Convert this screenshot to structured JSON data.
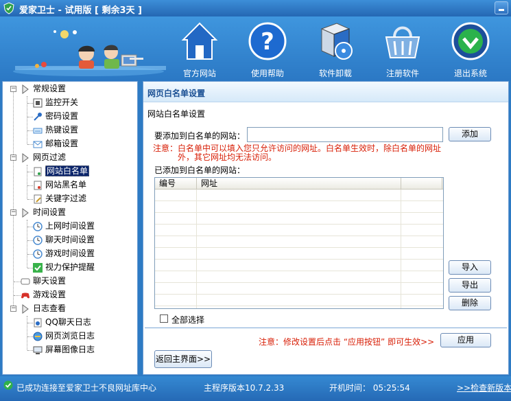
{
  "window": {
    "title": "爱家卫士 - 试用版 [ 剩余3天 ]"
  },
  "toolbar": {
    "items": [
      {
        "label": "官方网站",
        "icon": "home-icon"
      },
      {
        "label": "使用帮助",
        "icon": "help-icon"
      },
      {
        "label": "软件卸载",
        "icon": "uninstall-icon"
      },
      {
        "label": "注册软件",
        "icon": "basket-icon"
      },
      {
        "label": "退出系统",
        "icon": "exit-icon"
      }
    ]
  },
  "tree": {
    "groups": [
      {
        "label": "常规设置",
        "items": [
          "监控开关",
          "密码设置",
          "热键设置",
          "邮箱设置"
        ]
      },
      {
        "label": "网页过滤",
        "items": [
          "网站白名单",
          "网站黑名单",
          "关键字过滤"
        ]
      },
      {
        "label": "时间设置",
        "items": [
          "上网时间设置",
          "聊天时间设置",
          "游戏时间设置",
          "视力保护提醒"
        ]
      },
      {
        "label": "聊天设置"
      },
      {
        "label": "游戏设置"
      },
      {
        "label": "日志查看",
        "items": [
          "QQ聊天日志",
          "网页浏览日志",
          "屏幕图像日志"
        ]
      }
    ],
    "selected": "网站白名单"
  },
  "panel": {
    "header": "网页白名单设置",
    "subtitle": "网站白名单设置",
    "add_label": "要添加到白名单的网站：",
    "url_value": "",
    "add_button": "添加",
    "notice_line1": "注意：白名单中可以填入您只允许访问的网址。白名单生效时，除白名单的网址",
    "notice_line2": "外，其它网址均无法访问。",
    "list_label": "已添加到白名单的网站：",
    "columns": [
      "编号",
      "网址",
      ""
    ],
    "rows": [],
    "import_button": "导入",
    "export_button": "导出",
    "delete_button": "删除",
    "select_all": "全部选择",
    "apply_note": "注意：修改设置后点击 “应用按钮” 即可生效>>",
    "apply_button": "应用",
    "back_button": "返回主界面>>"
  },
  "status": {
    "connection": "已成功连接至爱家卫士不良网址库中心",
    "version": "主程序版本10.7.2.33",
    "boot_time": "开机时间： 05:25:54",
    "check_update": ">>检查新版本"
  }
}
